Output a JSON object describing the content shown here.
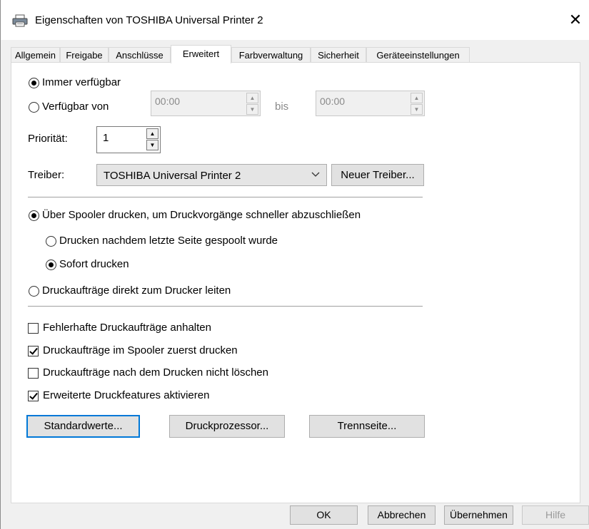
{
  "window": {
    "title": "Eigenschaften von TOSHIBA Universal Printer 2",
    "icon": "printer-icon",
    "close": "✕"
  },
  "tabs": [
    {
      "label": "Allgemein",
      "active": false
    },
    {
      "label": "Freigabe",
      "active": false
    },
    {
      "label": "Anschlüsse",
      "active": false
    },
    {
      "label": "Erweitert",
      "active": true
    },
    {
      "label": "Farbverwaltung",
      "active": false
    },
    {
      "label": "Sicherheit",
      "active": false
    },
    {
      "label": "Geräteeinstellungen",
      "active": false
    }
  ],
  "availability": {
    "always_label": "Immer verfügbar",
    "always_selected": true,
    "from_label": "Verfügbar von",
    "from_selected": false,
    "from_value": "00:00",
    "to_label": "bis",
    "to_value": "00:00"
  },
  "priority": {
    "label": "Priorität:",
    "value": "1"
  },
  "driver": {
    "label": "Treiber:",
    "value": "TOSHIBA Universal Printer 2",
    "new_button": "Neuer Treiber..."
  },
  "spooling": {
    "spool_label": "Über Spooler drucken, um Druckvorgänge schneller abzuschließen",
    "spool_selected": true,
    "after_last_page_label": "Drucken nachdem letzte Seite gespoolt wurde",
    "after_last_page_selected": false,
    "immediately_label": "Sofort drucken",
    "immediately_selected": true,
    "direct_label": "Druckaufträge direkt zum Drucker leiten",
    "direct_selected": false
  },
  "options": [
    {
      "label": "Fehlerhafte Druckaufträge anhalten",
      "checked": false
    },
    {
      "label": "Druckaufträge im Spooler zuerst drucken",
      "checked": true
    },
    {
      "label": "Druckaufträge nach dem Drucken nicht löschen",
      "checked": false
    },
    {
      "label": "Erweiterte Druckfeatures aktivieren",
      "checked": true
    }
  ],
  "panel_buttons": {
    "defaults": "Standardwerte...",
    "processor": "Druckprozessor...",
    "separator": "Trennseite..."
  },
  "dialog_buttons": {
    "ok": "OK",
    "cancel": "Abbrechen",
    "apply": "Übernehmen",
    "help": "Hilfe"
  },
  "colors": {
    "accent": "#0078d7",
    "panel_bg": "#ffffff",
    "window_bg": "#f0f0f0"
  }
}
